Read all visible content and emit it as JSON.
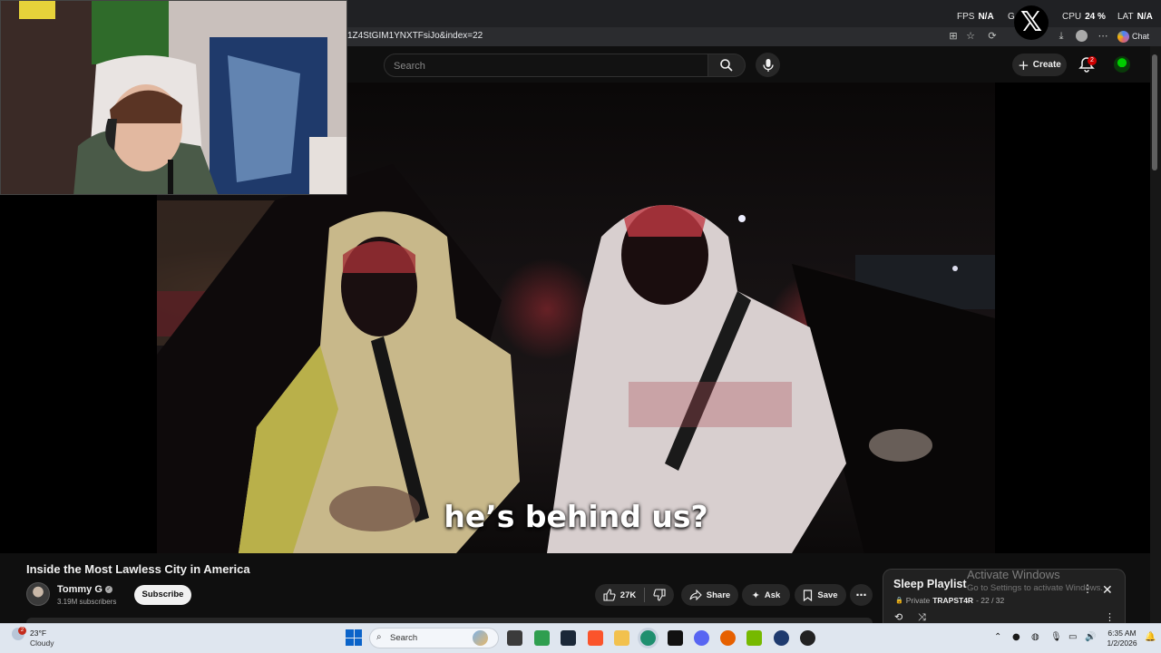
{
  "browser": {
    "url": "1Z4StGIM1YNXTFsiJo&index=22",
    "chat_label": "Chat"
  },
  "overlay": {
    "fps_label": "FPS",
    "fps_value": "N/A",
    "gpu_label": "G",
    "cpu_label": "CPU",
    "cpu_value": "24",
    "cpu_unit": "%",
    "lat_label": "LAT",
    "lat_value": "N/A"
  },
  "masthead": {
    "search_placeholder": "Search",
    "create_label": "Create",
    "notification_count": "2"
  },
  "video": {
    "subtitle": "he’s behind us?",
    "title": "Inside the Most Lawless City in America",
    "channel_name": "Tommy G",
    "subscribers": "3.19M subscribers",
    "subscribe_label": "Subscribe",
    "like_count": "27K",
    "share_label": "Share",
    "ask_label": "Ask",
    "save_label": "Save"
  },
  "playlist": {
    "title": "Sleep Playlist",
    "privacy": "Private",
    "owner": "TRAPST4R",
    "position": "- 22 / 32"
  },
  "watermark": {
    "line1": "Activate Windows",
    "line2": "Go to Settings to activate Windows."
  },
  "taskbar": {
    "weather_badge": "2",
    "temperature": "23°F",
    "weather": "Cloudy",
    "search_label": "Search",
    "time": "6:35 AM",
    "date": "1/2/2026"
  },
  "colors": {
    "youtube_bg": "#0f0f0f",
    "notification_red": "#cc0000",
    "taskbar_bg": "#dfe6ef",
    "windows_blue": "#0a63c9"
  },
  "icons": [
    "search-icon",
    "mic-icon",
    "plus-icon",
    "bell-icon",
    "like-icon",
    "dislike-icon",
    "share-icon",
    "sparkle-icon",
    "bookmark-icon",
    "more-icon",
    "close-icon",
    "loop-icon",
    "shuffle-icon",
    "lock-icon",
    "windows-start-icon"
  ]
}
